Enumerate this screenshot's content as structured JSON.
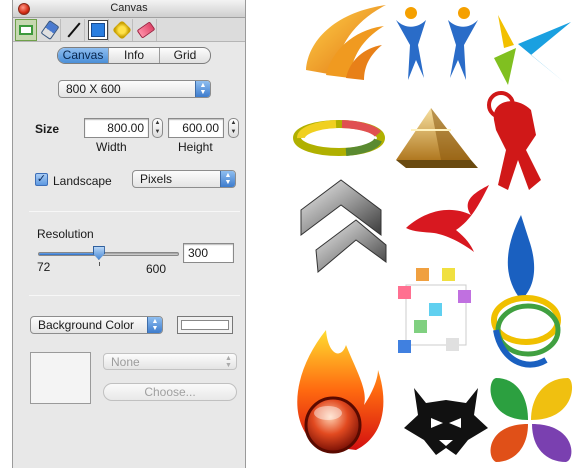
{
  "window": {
    "title": "Canvas"
  },
  "toolbar": {
    "tools": [
      {
        "name": "rectangle-tool-icon"
      },
      {
        "name": "brush-tool-icon"
      },
      {
        "name": "line-tool-icon"
      },
      {
        "name": "frame-tool-icon"
      },
      {
        "name": "magic-wand-tool-icon"
      },
      {
        "name": "eraser-tool-icon"
      }
    ]
  },
  "tabs": [
    {
      "label": "Canvas",
      "active": true
    },
    {
      "label": "Info",
      "active": false
    },
    {
      "label": "Grid",
      "active": false
    }
  ],
  "canvas": {
    "size_preset": "800 X 600",
    "size_label": "Size",
    "width_value": "800.00",
    "width_label": "Width",
    "height_value": "600.00",
    "height_label": "Height",
    "landscape_label": "Landscape",
    "landscape_checked": true,
    "units": "Pixels"
  },
  "resolution": {
    "label": "Resolution",
    "min_label": "72",
    "max_label": "600",
    "value": "300"
  },
  "background": {
    "mode": "Background Color",
    "color": "#ffffff",
    "image_select": "None",
    "choose_label": "Choose..."
  },
  "colors": {
    "accent_blue": "#4b8fd8",
    "selected_tool_green": "#c6d8b0"
  }
}
